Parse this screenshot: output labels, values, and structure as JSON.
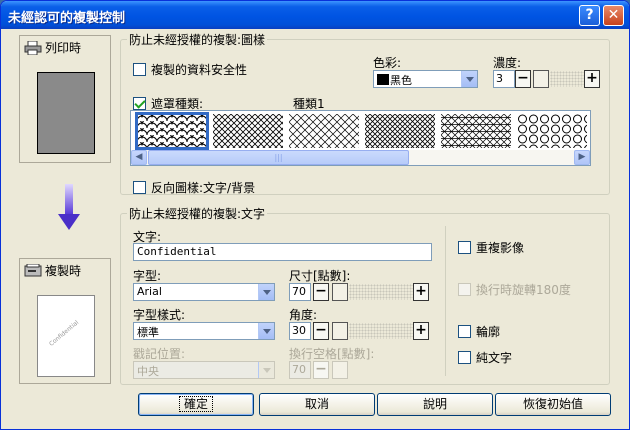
{
  "window": {
    "title": "未經認可的複製控制"
  },
  "left": {
    "print_label": "列印時",
    "copy_label": "複製時",
    "copy_watermark": "Confidential"
  },
  "pattern_group": {
    "legend": "防止未經授權的複製:圖樣",
    "secure_copy_label": "複製的資料安全性",
    "secure_copy_checked": false,
    "color_label": "色彩:",
    "color_value": "黑色",
    "density_label": "濃度:",
    "density_value": "3",
    "density_level": 3,
    "mask_type_label": "遮罩種類:",
    "mask_type_checked": true,
    "mask_type_value": "種類1",
    "patterns": [
      "scales",
      "diamond-fine",
      "diamond-mesh",
      "diamond-dense",
      "cross-hatch",
      "circles"
    ],
    "selected_pattern": 0,
    "invert_label": "反向圖樣:文字/背景",
    "invert_checked": false
  },
  "text_group": {
    "legend": "防止未經授權的複製:文字",
    "text_label": "文字:",
    "text_value": "Confidential",
    "font_label": "字型:",
    "font_value": "Arial",
    "size_label": "尺寸[點數]:",
    "size_value": "70",
    "style_label": "字型樣式:",
    "style_value": "標準",
    "angle_label": "角度:",
    "angle_value": "30",
    "position_label": "戳記位置:",
    "position_value": "中央",
    "spacing_label": "換行空格[點數]:",
    "spacing_value": "70",
    "repeat_label": "重複影像",
    "repeat_checked": false,
    "rotate_label": "換行時旋轉180度",
    "rotate_checked": false,
    "outline_label": "輪廓",
    "outline_checked": false,
    "plain_label": "純文字",
    "plain_checked": false
  },
  "buttons": {
    "ok": "確定",
    "cancel": "取消",
    "help": "說明",
    "reset": "恢復初始值"
  }
}
